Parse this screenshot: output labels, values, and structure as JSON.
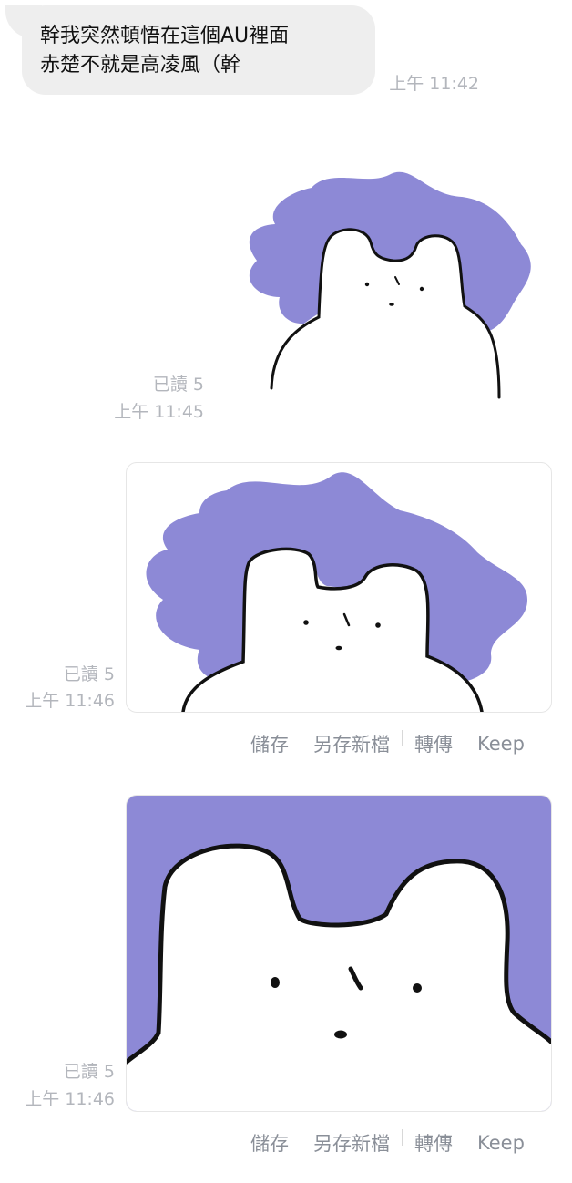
{
  "messages": {
    "received": {
      "text": "幹我突然頓悟在這個AU裡面\n赤楚不就是高凌風（幹",
      "time": "上午 11:42"
    },
    "sticker": {
      "read": "已讀 5",
      "time": "上午 11:45"
    },
    "image1": {
      "read": "已讀 5",
      "time": "上午 11:46"
    },
    "image2": {
      "read": "已讀 5",
      "time": "上午 11:46"
    }
  },
  "actions": {
    "save": "儲存",
    "save_as": "另存新檔",
    "forward": "轉傳",
    "keep": "Keep"
  },
  "colors": {
    "purple": "#8d89d6",
    "bubble": "#eeeeee",
    "meta_text": "#b3b6bc",
    "action_text": "#8a8f98"
  }
}
